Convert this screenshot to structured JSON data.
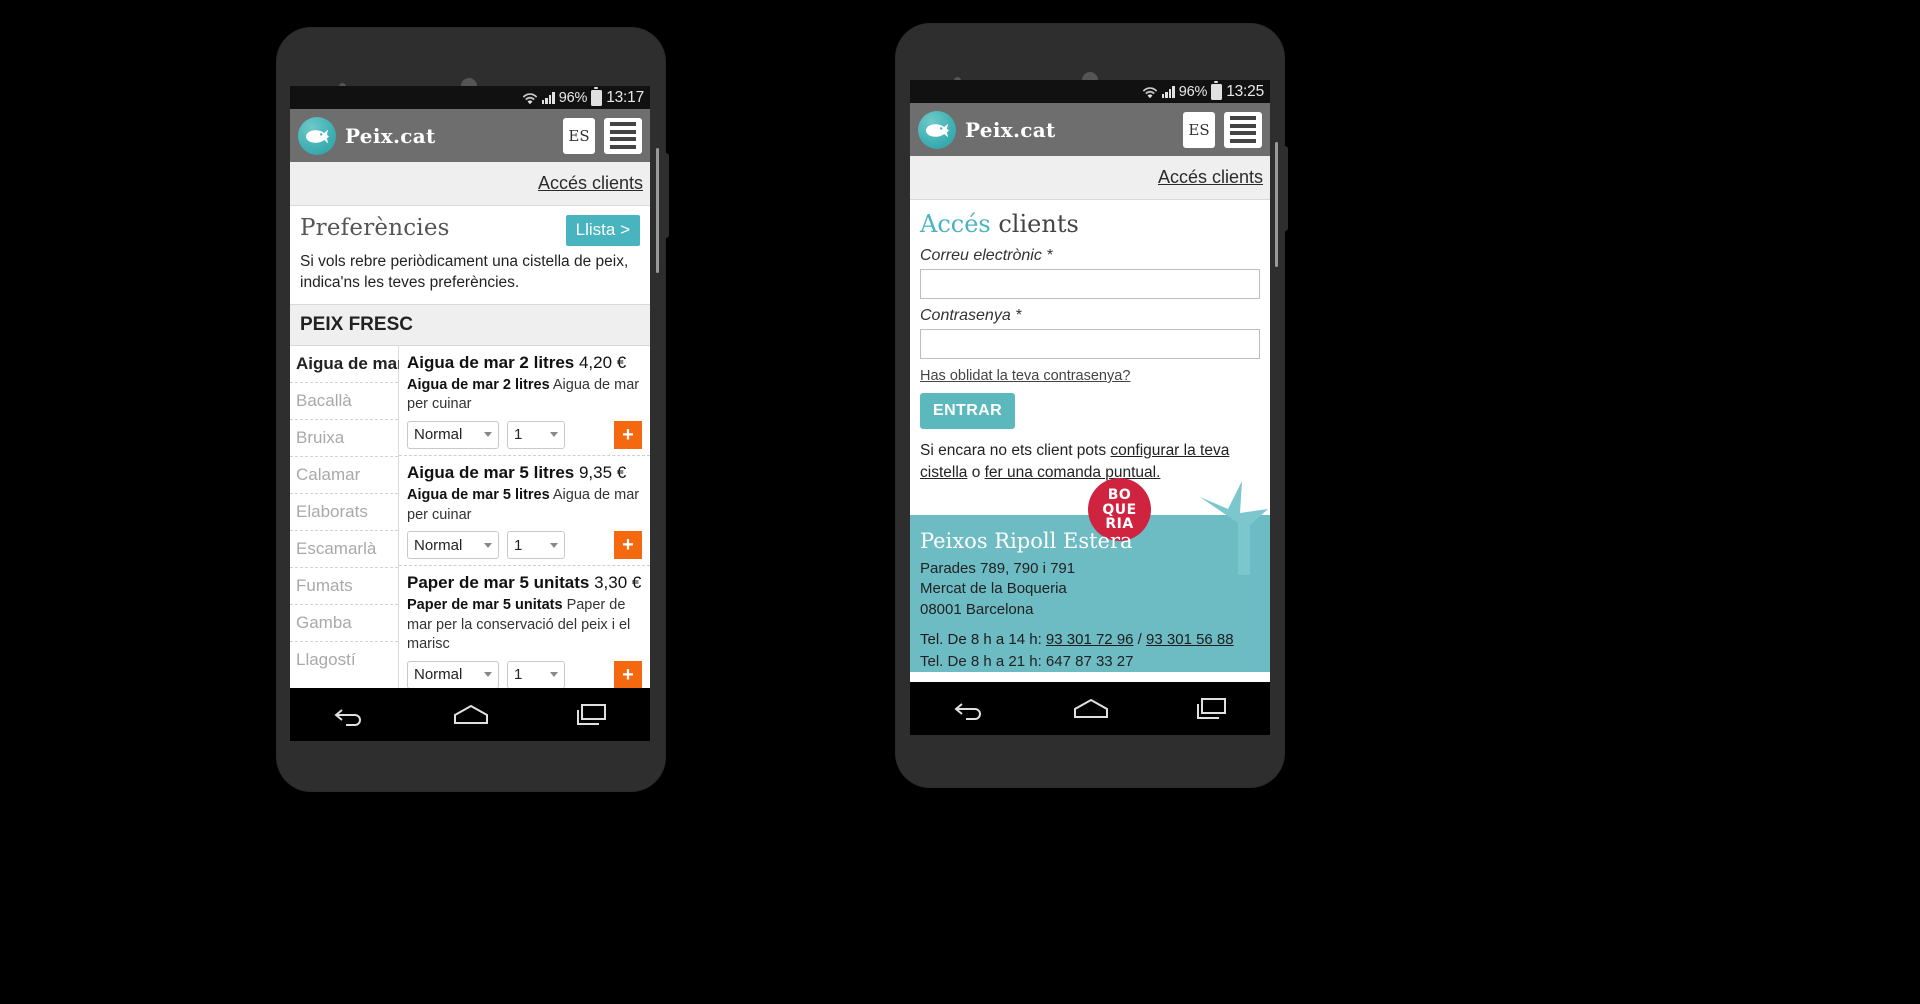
{
  "left_phone": {
    "status_bar": {
      "battery_pct": "96%",
      "time": "13:17",
      "wifi_icon": "wifi-icon",
      "signal_icon": "signal-bars-icon",
      "battery_icon": "battery-icon"
    },
    "header": {
      "brand": "Peix.cat",
      "logo_icon": "fish-logo-icon",
      "lang_button": "ES",
      "menu_icon": "hamburger-menu-icon"
    },
    "acces_bar": {
      "link": "Accés clients"
    },
    "preferences": {
      "title": "Preferències",
      "list_button": "Llista >",
      "description": "Si vols rebre periòdicament una cistella de peix, indica'ns les teves preferències."
    },
    "section_title": "PEIX FRESC",
    "categories": [
      {
        "label": "Aigua de mar",
        "active": true
      },
      {
        "label": "Bacallà",
        "active": false
      },
      {
        "label": "Bruixa",
        "active": false
      },
      {
        "label": "Calamar",
        "active": false
      },
      {
        "label": "Elaborats",
        "active": false
      },
      {
        "label": "Escamarlà",
        "active": false
      },
      {
        "label": "Fumats",
        "active": false
      },
      {
        "label": "Gamba",
        "active": false
      },
      {
        "label": "Llagostí",
        "active": false
      }
    ],
    "products": [
      {
        "name": "Aigua de mar 2 litres",
        "price": "4,20 €",
        "desc_bold": "Aigua de mar 2 litres",
        "desc_rest": "Aigua de mar per cuinar",
        "cut_option": "Normal",
        "quantity": "1",
        "add_label": "+"
      },
      {
        "name": "Aigua de mar 5 litres",
        "price": "9,35 €",
        "desc_bold": "Aigua de mar 5 litres",
        "desc_rest": "Aigua de mar per cuinar",
        "cut_option": "Normal",
        "quantity": "1",
        "add_label": "+"
      },
      {
        "name": "Paper de mar 5 unitats",
        "price": "3,30 €",
        "desc_bold": "Paper de mar 5 unitats",
        "desc_rest": "Paper de mar per la conservació del peix i el marisc",
        "cut_option": "Normal",
        "quantity": "1",
        "add_label": "+"
      }
    ],
    "nav": {
      "back_icon": "back-arrow-icon",
      "home_icon": "home-icon",
      "recents_icon": "recent-apps-icon"
    }
  },
  "right_phone": {
    "status_bar": {
      "battery_pct": "96%",
      "time": "13:25",
      "wifi_icon": "wifi-icon",
      "signal_icon": "signal-bars-icon",
      "battery_icon": "battery-icon"
    },
    "header": {
      "brand": "Peix.cat",
      "logo_icon": "fish-logo-icon",
      "lang_button": "ES",
      "menu_icon": "hamburger-menu-icon"
    },
    "acces_bar": {
      "link": "Accés clients"
    },
    "login": {
      "title_accent": "Accés",
      "title_rest": " clients",
      "email_label": "Correu electrònic *",
      "email_value": "",
      "password_label": "Contrasenya *",
      "password_value": "",
      "forgot_link": "Has oblidat la teva contrasenya?",
      "submit_button": "ENTRAR",
      "signup_prefix": "Si encara no ets client pots ",
      "signup_link1": "configurar la teva cistella",
      "signup_middle": " o ",
      "signup_link2": "fer una comanda puntual."
    },
    "footer": {
      "badge_lines": [
        "BO",
        "QUE",
        "RIA"
      ],
      "shop_name": "Peixos Ripoll Estera",
      "address_line1": "Parades 789, 790 i 791",
      "address_line2": "Mercat de la Boqueria",
      "address_line3": "08001 Barcelona",
      "tel_label_1": "Tel. De 8 h a 14 h: ",
      "tel_1a": "93 301 72 96",
      "tel_sep": " / ",
      "tel_1b": "93 301 56 88",
      "tel_label_2": "Tel. De 8 h a 21 h: 647 87 33 27"
    },
    "nav": {
      "back_icon": "back-arrow-icon",
      "home_icon": "home-icon",
      "recents_icon": "recent-apps-icon"
    }
  },
  "colors": {
    "brand_teal": "#48b4bf",
    "footer_teal": "#6dbcc4",
    "accent_orange": "#f4690f",
    "badge_red": "#cf2340",
    "header_gray": "#6e6e6e"
  }
}
